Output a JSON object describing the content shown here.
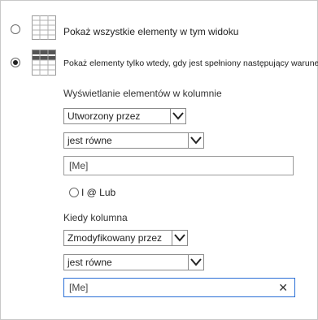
{
  "options": [
    {
      "label": "Pokaż wszystkie elementy w tym widoku",
      "selected": false,
      "icon": "table-icon"
    },
    {
      "label": "Pokaż elementy tylko wtedy, gdy jest spełniony następujący warunek",
      "selected": true,
      "icon": "filtered-table-icon"
    }
  ],
  "condition1": {
    "heading": "Wyświetlanie elementów w kolumnie",
    "column": "Utworzony przez",
    "operator": "jest równe",
    "value": "[Me]"
  },
  "connector": {
    "label": "I @ Lub",
    "selected": false
  },
  "condition2": {
    "heading": "Kiedy kolumna",
    "column": "Zmodyfikowany przez",
    "operator": "jest równe",
    "value": "[Me]",
    "clear_icon": "close-icon",
    "clear_glyph": "✕"
  },
  "colors": {
    "focus_border": "#2a6fd6",
    "border": "#8a8a8a"
  }
}
